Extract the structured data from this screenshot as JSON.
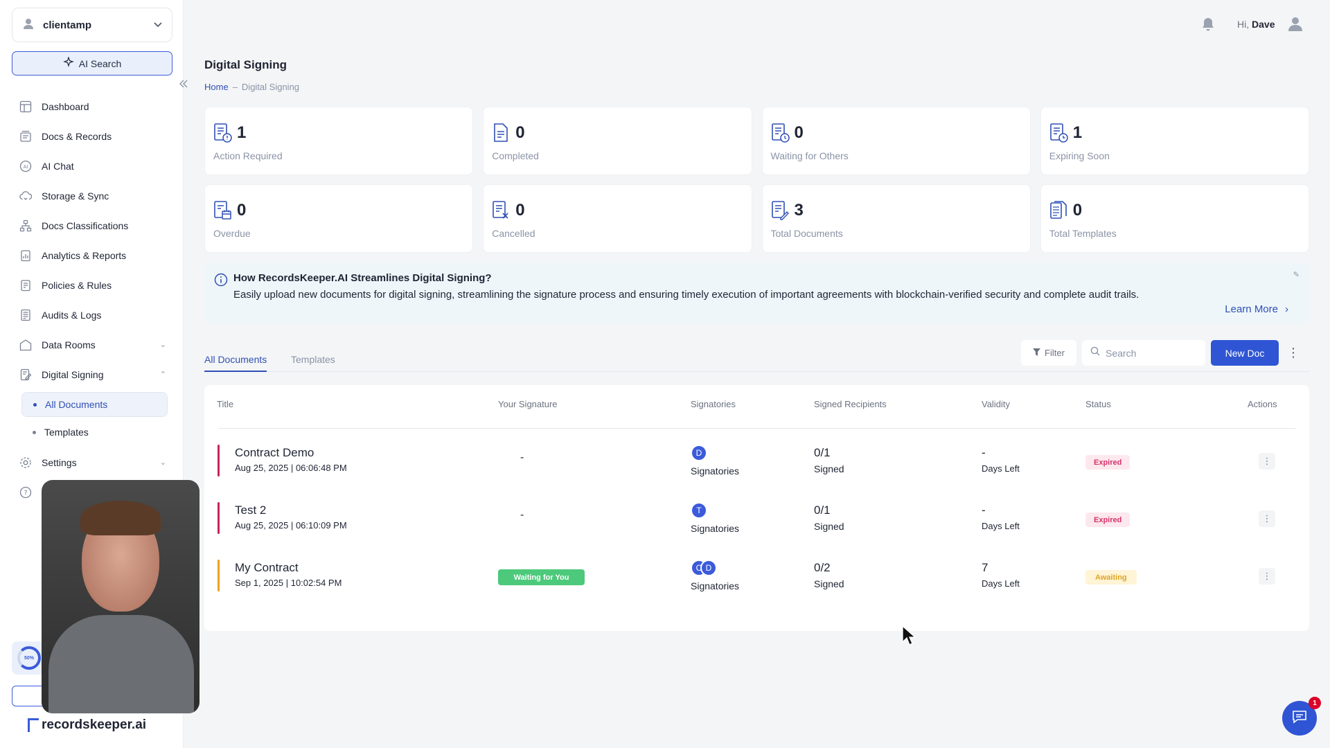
{
  "sidebar": {
    "workspace": "clientamp",
    "ai_search": "AI Search",
    "items": [
      {
        "label": "Dashboard",
        "icon": "dashboard-icon"
      },
      {
        "label": "Docs & Records",
        "icon": "docs-icon"
      },
      {
        "label": "AI Chat",
        "icon": "ai-chat-icon"
      },
      {
        "label": "Storage & Sync",
        "icon": "cloud-sync-icon"
      },
      {
        "label": "Docs Classifications",
        "icon": "hierarchy-icon"
      },
      {
        "label": "Analytics & Reports",
        "icon": "analytics-icon"
      },
      {
        "label": "Policies & Rules",
        "icon": "policy-icon"
      },
      {
        "label": "Audits & Logs",
        "icon": "audit-icon"
      },
      {
        "label": "Data Rooms",
        "icon": "data-room-icon"
      },
      {
        "label": "Digital Signing",
        "icon": "signing-icon"
      },
      {
        "label": "Settings",
        "icon": "gear-icon"
      }
    ],
    "sub_items": [
      "All Documents",
      "Templates"
    ],
    "progress_label": "50%",
    "brand": "recordskeeper.ai"
  },
  "header": {
    "greeting": "Hi,",
    "user": "Dave"
  },
  "page": {
    "title": "Digital Signing",
    "breadcrumb_home": "Home",
    "breadcrumb_sep": "–",
    "breadcrumb_current": "Digital Signing"
  },
  "stats": [
    {
      "value": "1",
      "label": "Action Required"
    },
    {
      "value": "0",
      "label": "Completed"
    },
    {
      "value": "0",
      "label": "Waiting for Others"
    },
    {
      "value": "1",
      "label": "Expiring Soon"
    },
    {
      "value": "0",
      "label": "Overdue"
    },
    {
      "value": "0",
      "label": "Cancelled"
    },
    {
      "value": "3",
      "label": "Total Documents"
    },
    {
      "value": "0",
      "label": "Total Templates"
    }
  ],
  "info": {
    "question": "How RecordsKeeper.AI Streamlines Digital Signing?",
    "text": "Easily upload new documents for digital signing, streamlining the signature process and ensuring timely execution of important agreements with blockchain-verified security and complete audit trails.",
    "learn_more": "Learn More"
  },
  "tabs": [
    "All Documents",
    "Templates"
  ],
  "toolbar": {
    "filter": "Filter",
    "search_placeholder": "Search",
    "new_doc": "New Doc"
  },
  "table": {
    "columns": [
      "Title",
      "Your Signature",
      "Signatories",
      "Signed Recipients",
      "Validity",
      "Status",
      "Actions"
    ],
    "rows": [
      {
        "title": "Contract Demo",
        "date": "Aug 25, 2025 | 06:06:48 PM",
        "signature": "-",
        "avatars": [
          "D"
        ],
        "signatories": "Signatories",
        "signed": "0/1",
        "signed_label": "Signed",
        "validity": "-",
        "days_label": "Days Left",
        "status": "Expired",
        "bar_color": "#c2255c"
      },
      {
        "title": "Test 2",
        "date": "Aug 25, 2025 | 06:10:09 PM",
        "signature": "-",
        "avatars": [
          "T"
        ],
        "signatories": "Signatories",
        "signed": "0/1",
        "signed_label": "Signed",
        "validity": "-",
        "days_label": "Days Left",
        "status": "Expired",
        "bar_color": "#c2255c"
      },
      {
        "title": "My Contract",
        "date": "Sep 1, 2025 | 10:02:54 PM",
        "signature": "Waiting for You",
        "avatars": [
          "C",
          "D"
        ],
        "signatories": "Signatories",
        "signed": "0/2",
        "signed_label": "Signed",
        "validity": "7",
        "days_label": "Days Left",
        "status": "Awaiting",
        "bar_color": "#f0a020"
      }
    ]
  },
  "chat": {
    "unread": "1"
  }
}
